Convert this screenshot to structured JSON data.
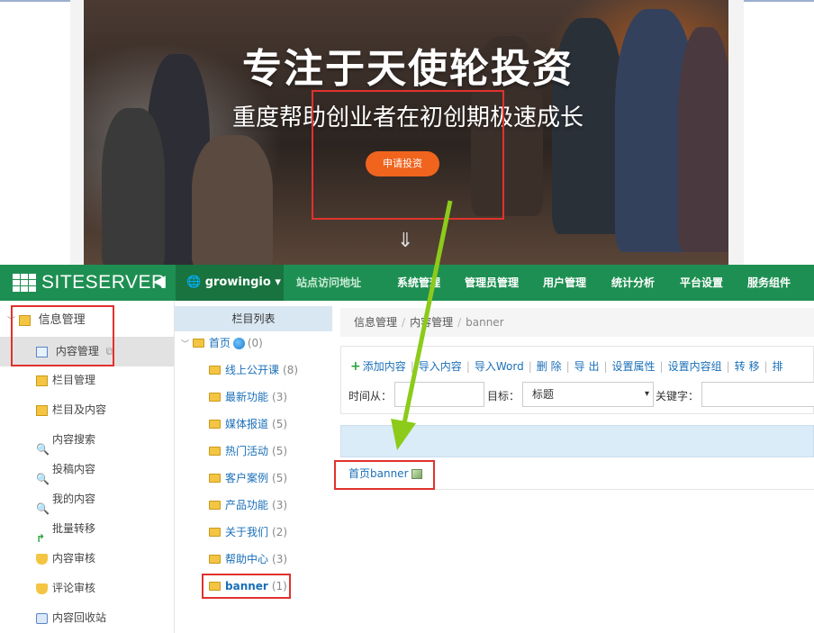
{
  "banner": {
    "title": "专注于天使轮投资",
    "subtitle": "重度帮助创业者在初创期极速成长",
    "button": "申请投资",
    "scroll_icon": "down-arrow-icon"
  },
  "nav": {
    "brand": "SITESERVER",
    "back_icon": "back-arrow-icon",
    "site_name": "growingio",
    "menu": [
      "站点访问地址",
      "系统管理",
      "管理员管理",
      "用户管理",
      "统计分析",
      "平台设置",
      "服务组件"
    ]
  },
  "sidebar": {
    "group": "信息管理",
    "items": [
      "内容管理",
      "栏目管理",
      "栏目及内容",
      "内容搜索",
      "投稿内容",
      "我的内容",
      "批量转移",
      "内容审核",
      "评论审核",
      "内容回收站"
    ]
  },
  "tree": {
    "header": "栏目列表",
    "root": {
      "label": "首页",
      "count": "(0)"
    },
    "children": [
      {
        "label": "线上公开课",
        "count": "(8)"
      },
      {
        "label": "最新功能",
        "count": "(3)"
      },
      {
        "label": "媒体报道",
        "count": "(5)"
      },
      {
        "label": "热门活动",
        "count": "(5)"
      },
      {
        "label": "客户案例",
        "count": "(5)"
      },
      {
        "label": "产品功能",
        "count": "(3)"
      },
      {
        "label": "关于我们",
        "count": "(2)"
      },
      {
        "label": "帮助中心",
        "count": "(3)"
      },
      {
        "label": "banner",
        "count": "(1)"
      }
    ]
  },
  "main": {
    "breadcrumb": [
      "信息管理",
      "内容管理",
      "banner"
    ],
    "tools": [
      "添加内容",
      "导入内容",
      "导入Word",
      "删 除",
      "导 出",
      "设置属性",
      "设置内容组",
      "转 移",
      "排"
    ],
    "filter": {
      "time_label": "时间从：",
      "target_label": "目标：",
      "target_value": "标题",
      "keyword_label": "关键字："
    },
    "rows": [
      {
        "title": "首页banner"
      }
    ]
  },
  "colors": {
    "nav_green": "#1e8f52",
    "nav_dark": "#18733f",
    "highlight_red": "#e0322e",
    "arrow_green": "#8ccb1a"
  }
}
